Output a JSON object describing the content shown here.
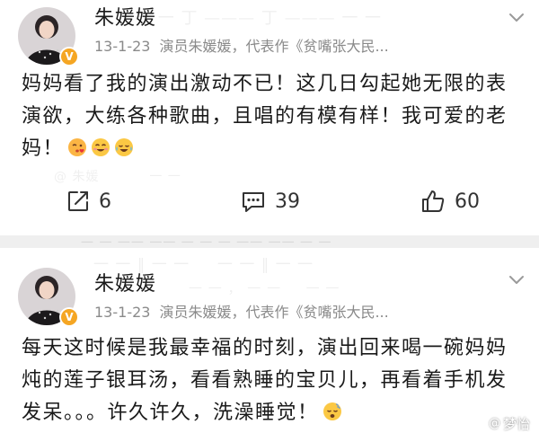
{
  "colors": {
    "verified_badge": "#f5a623",
    "meta_text": "#8a8a8a",
    "body_text": "#1a1a1a",
    "separator": "#efefef"
  },
  "posts": [
    {
      "author": "朱媛媛",
      "date": "13-1-23",
      "source": "演员朱媛媛，代表作《贫嘴张大民...",
      "body": "妈妈看了我的演出激动不已！这几日勾起她无限的表演欲，大练各种歌曲，且唱的有模有样！我可爱的老妈！",
      "emojis": [
        "kissing-heart-emoji",
        "grinning-blush-emoji",
        "joy-tears-emoji"
      ],
      "actions": {
        "share_icon": "share-edit-icon",
        "share_count": "6",
        "comment_icon": "comment-icon",
        "comment_count": "39",
        "like_icon": "thumbs-up-icon",
        "like_count": "60"
      }
    },
    {
      "author": "朱媛媛",
      "date": "13-1-23",
      "source": "演员朱媛媛，代表作《贫嘴张大民...",
      "body": "每天这时候是我最幸福的时刻，演出回来喝一碗妈妈炖的莲子银耳汤，看看熟睡的宝贝儿，再看着手机发发呆。。。许久许久，洗澡睡觉！",
      "emojis": [
        "sleepy-emoji"
      ]
    }
  ],
  "watermark": {
    "icon": "@",
    "text": "梦怡"
  }
}
